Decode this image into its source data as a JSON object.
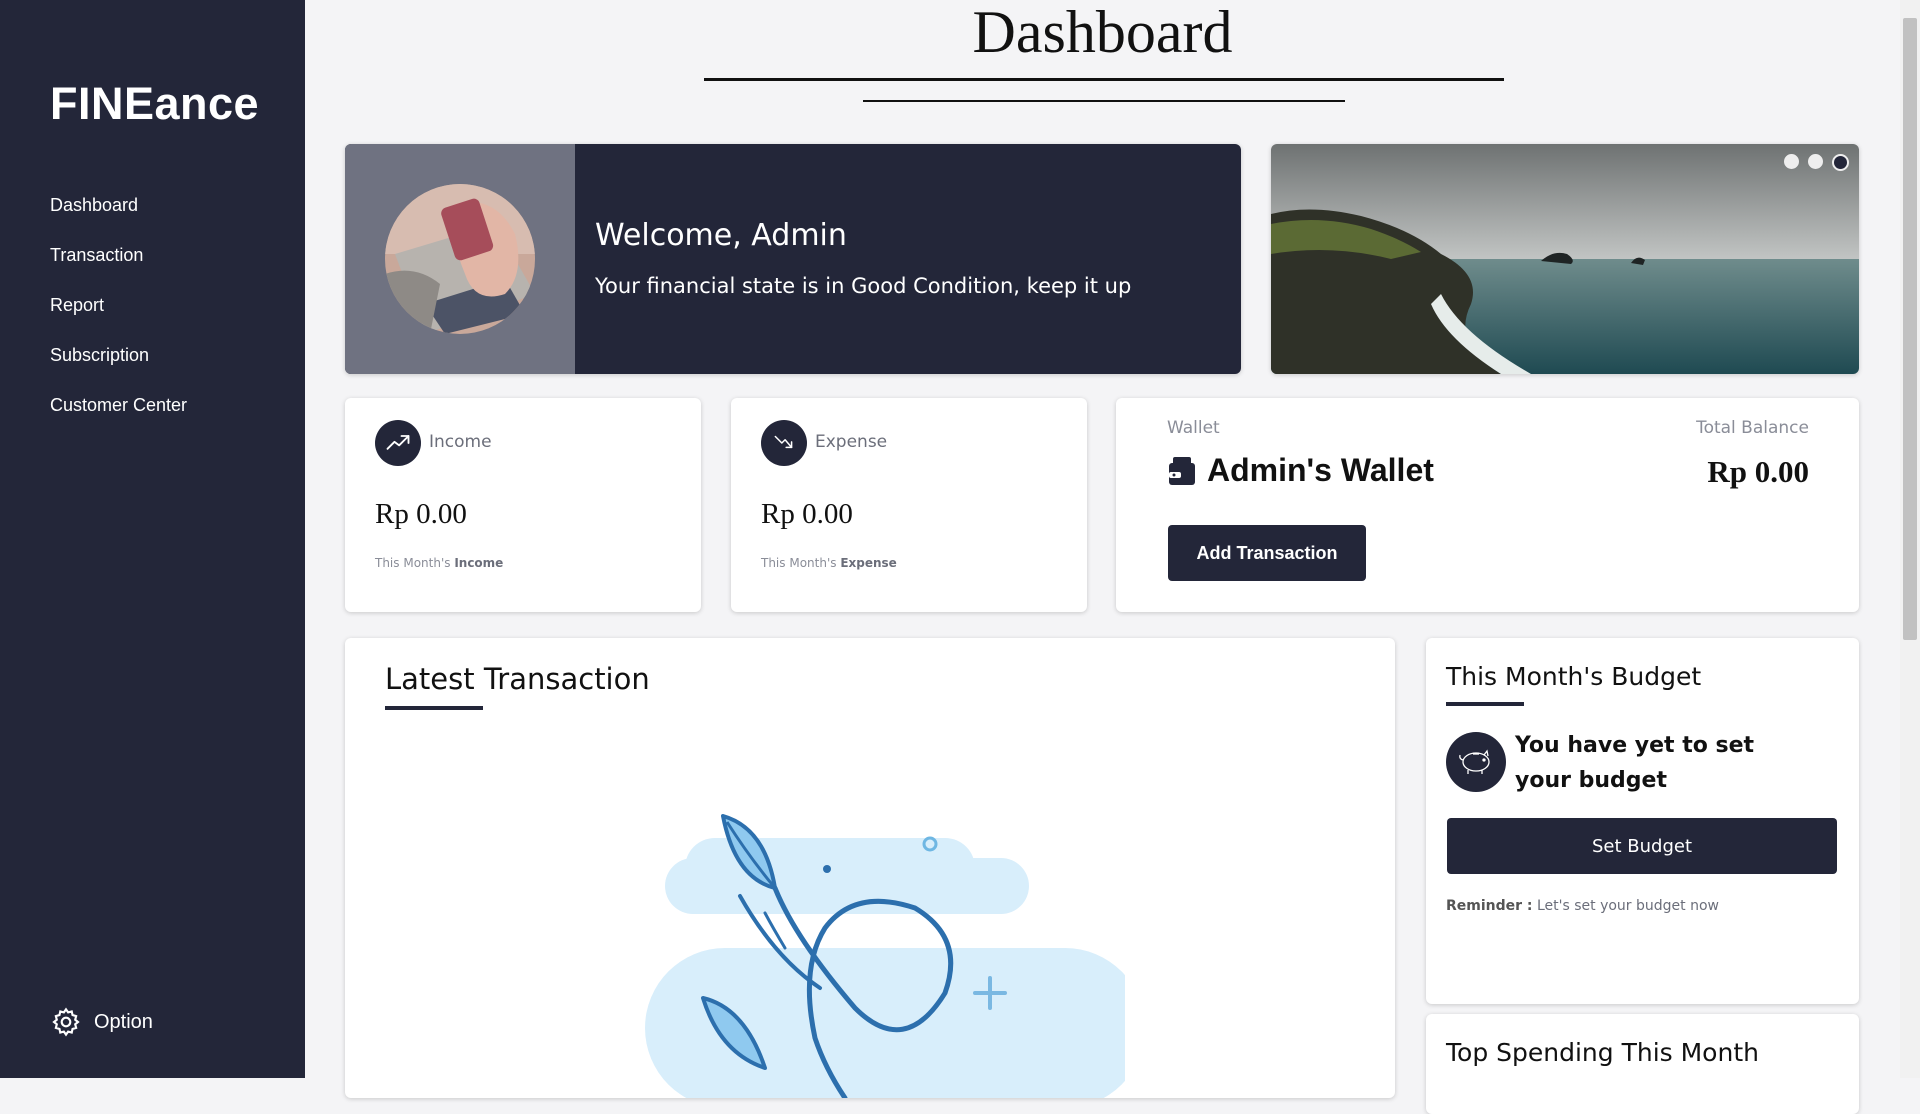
{
  "sidebar": {
    "brand": "FINEance",
    "items": [
      {
        "label": "Dashboard"
      },
      {
        "label": "Transaction"
      },
      {
        "label": "Report"
      },
      {
        "label": "Subscription"
      },
      {
        "label": "Customer Center"
      }
    ],
    "option_label": "Option",
    "background": "#232639"
  },
  "header": {
    "title": "Dashboard"
  },
  "welcome": {
    "title": "Welcome, Admin",
    "message": "Your financial state is in Good Condition, keep it up"
  },
  "carousel": {
    "slide_count": 3,
    "active_index": 2
  },
  "income": {
    "label": "Income",
    "amount": "Rp 0.00",
    "sub_prefix": "This Month's ",
    "sub_bold": "Income",
    "icon": "trending-up-icon"
  },
  "expense": {
    "label": "Expense",
    "amount": "Rp 0.00",
    "sub_prefix": "This Month's ",
    "sub_bold": "Expense",
    "icon": "trending-down-icon"
  },
  "wallet": {
    "label": "Wallet",
    "name": "Admin's Wallet",
    "balance_label": "Total Balance",
    "balance": "Rp 0.00",
    "add_button": "Add Transaction"
  },
  "latest": {
    "title": "Latest Transaction"
  },
  "budget": {
    "title": "This Month's Budget",
    "message": "You have yet to set your budget",
    "button": "Set Budget",
    "reminder_label": "Reminder :",
    "reminder_text": " Let's set your budget now"
  },
  "top_spending": {
    "title": "Top Spending This Month"
  },
  "colors": {
    "accent": "#232639",
    "background": "#f4f4f6"
  }
}
